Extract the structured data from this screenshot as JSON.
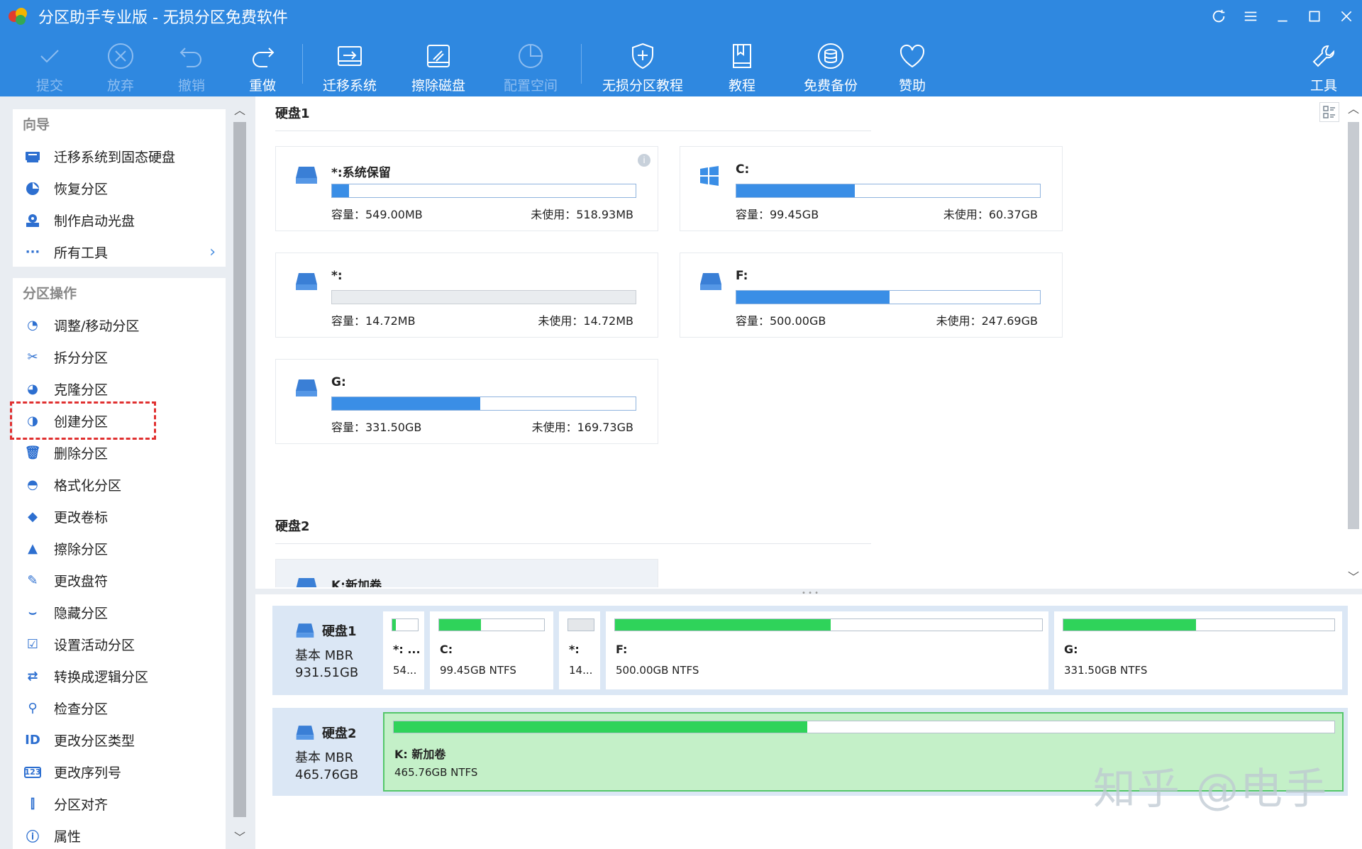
{
  "window": {
    "title": "分区助手专业版 - 无损分区免费软件"
  },
  "toolbar": {
    "commit": "提交",
    "discard": "放弃",
    "undo": "撤销",
    "redo": "重做",
    "migrate": "迁移系统",
    "wipe_disk": "擦除磁盘",
    "allocate_space": "配置空间",
    "tutorial_lossless": "无损分区教程",
    "tutorial": "教程",
    "free_backup": "免费备份",
    "sponsor": "赞助",
    "tools": "工具"
  },
  "sidebar": {
    "wizard_title": "向导",
    "wizard_items": [
      {
        "label": "迁移系统到固态硬盘",
        "icon": "ssd-migrate-icon"
      },
      {
        "label": "恢复分区",
        "icon": "recover-partition-icon"
      },
      {
        "label": "制作启动光盘",
        "icon": "boot-disc-icon"
      },
      {
        "label": "所有工具",
        "icon": "more-dots-icon"
      }
    ],
    "ops_title": "分区操作",
    "ops_items": [
      {
        "label": "调整/移动分区",
        "icon": "resize-move-icon"
      },
      {
        "label": "拆分分区",
        "icon": "split-icon"
      },
      {
        "label": "克隆分区",
        "icon": "clone-icon"
      },
      {
        "label": "创建分区",
        "icon": "create-partition-icon"
      },
      {
        "label": "删除分区",
        "icon": "trash-icon"
      },
      {
        "label": "格式化分区",
        "icon": "format-icon"
      },
      {
        "label": "更改卷标",
        "icon": "tag-icon"
      },
      {
        "label": "擦除分区",
        "icon": "broom-icon"
      },
      {
        "label": "更改盘符",
        "icon": "pencil-icon"
      },
      {
        "label": "隐藏分区",
        "icon": "hidden-eye-icon"
      },
      {
        "label": "设置活动分区",
        "icon": "set-active-icon"
      },
      {
        "label": "转换成逻辑分区",
        "icon": "convert-icon"
      },
      {
        "label": "检查分区",
        "icon": "check-icon"
      },
      {
        "label": "更改分区类型",
        "icon": "id-icon"
      },
      {
        "label": "更改序列号",
        "icon": "serial-icon"
      },
      {
        "label": "分区对齐",
        "icon": "align-icon"
      },
      {
        "label": "属性",
        "icon": "info-icon"
      }
    ]
  },
  "main": {
    "disk1_header": "硬盘1",
    "disk2_header": "硬盘2",
    "cards": [
      {
        "name": "*:系统保留",
        "capacity": "容量：549.00MB",
        "free": "未使用：518.93MB",
        "used_fraction": 0.055,
        "icon": "drive-icon"
      },
      {
        "name": "C:",
        "capacity": "容量：99.45GB",
        "free": "未使用：60.37GB",
        "used_fraction": 0.39,
        "icon": "windows-icon"
      },
      {
        "name": "*:",
        "capacity": "容量：14.72MB",
        "free": "未使用：14.72MB",
        "used_fraction": 0.0,
        "icon": "drive-icon"
      },
      {
        "name": "F:",
        "capacity": "容量：500.00GB",
        "free": "未使用：247.69GB",
        "used_fraction": 0.505,
        "icon": "drive-icon"
      },
      {
        "name": "G:",
        "capacity": "容量：331.50GB",
        "free": "未使用：169.73GB",
        "used_fraction": 0.488,
        "icon": "drive-icon"
      },
      {
        "name": "K:新加卷",
        "icon": "drive-icon"
      }
    ]
  },
  "diskmap": {
    "disk1": {
      "name": "硬盘1",
      "type": "基本 MBR",
      "size": "931.51GB"
    },
    "disk2": {
      "name": "硬盘2",
      "type": "基本 MBR",
      "size": "465.76GB"
    },
    "disk1_parts": [
      {
        "label": "*: ...",
        "detail": "54...",
        "used_fraction": 0.15
      },
      {
        "label": "C:",
        "detail": "99.45GB NTFS",
        "used_fraction": 0.4
      },
      {
        "label": "*:",
        "detail": "14...",
        "used_fraction": 0.0
      },
      {
        "label": "F:",
        "detail": "500.00GB NTFS",
        "used_fraction": 0.505
      },
      {
        "label": "G:",
        "detail": "331.50GB NTFS",
        "used_fraction": 0.49
      }
    ],
    "disk2_parts": [
      {
        "label": "K: 新加卷",
        "detail": "465.76GB NTFS",
        "used_fraction": 0.44
      }
    ]
  },
  "watermark": "知乎 @电手",
  "colors": {
    "titlebar": "#2f88e0",
    "accent": "#3a8ee6",
    "used_green": "#2fd35a",
    "selected_partition": "#c4f0c8",
    "highlight_dashed": "#e03030"
  }
}
